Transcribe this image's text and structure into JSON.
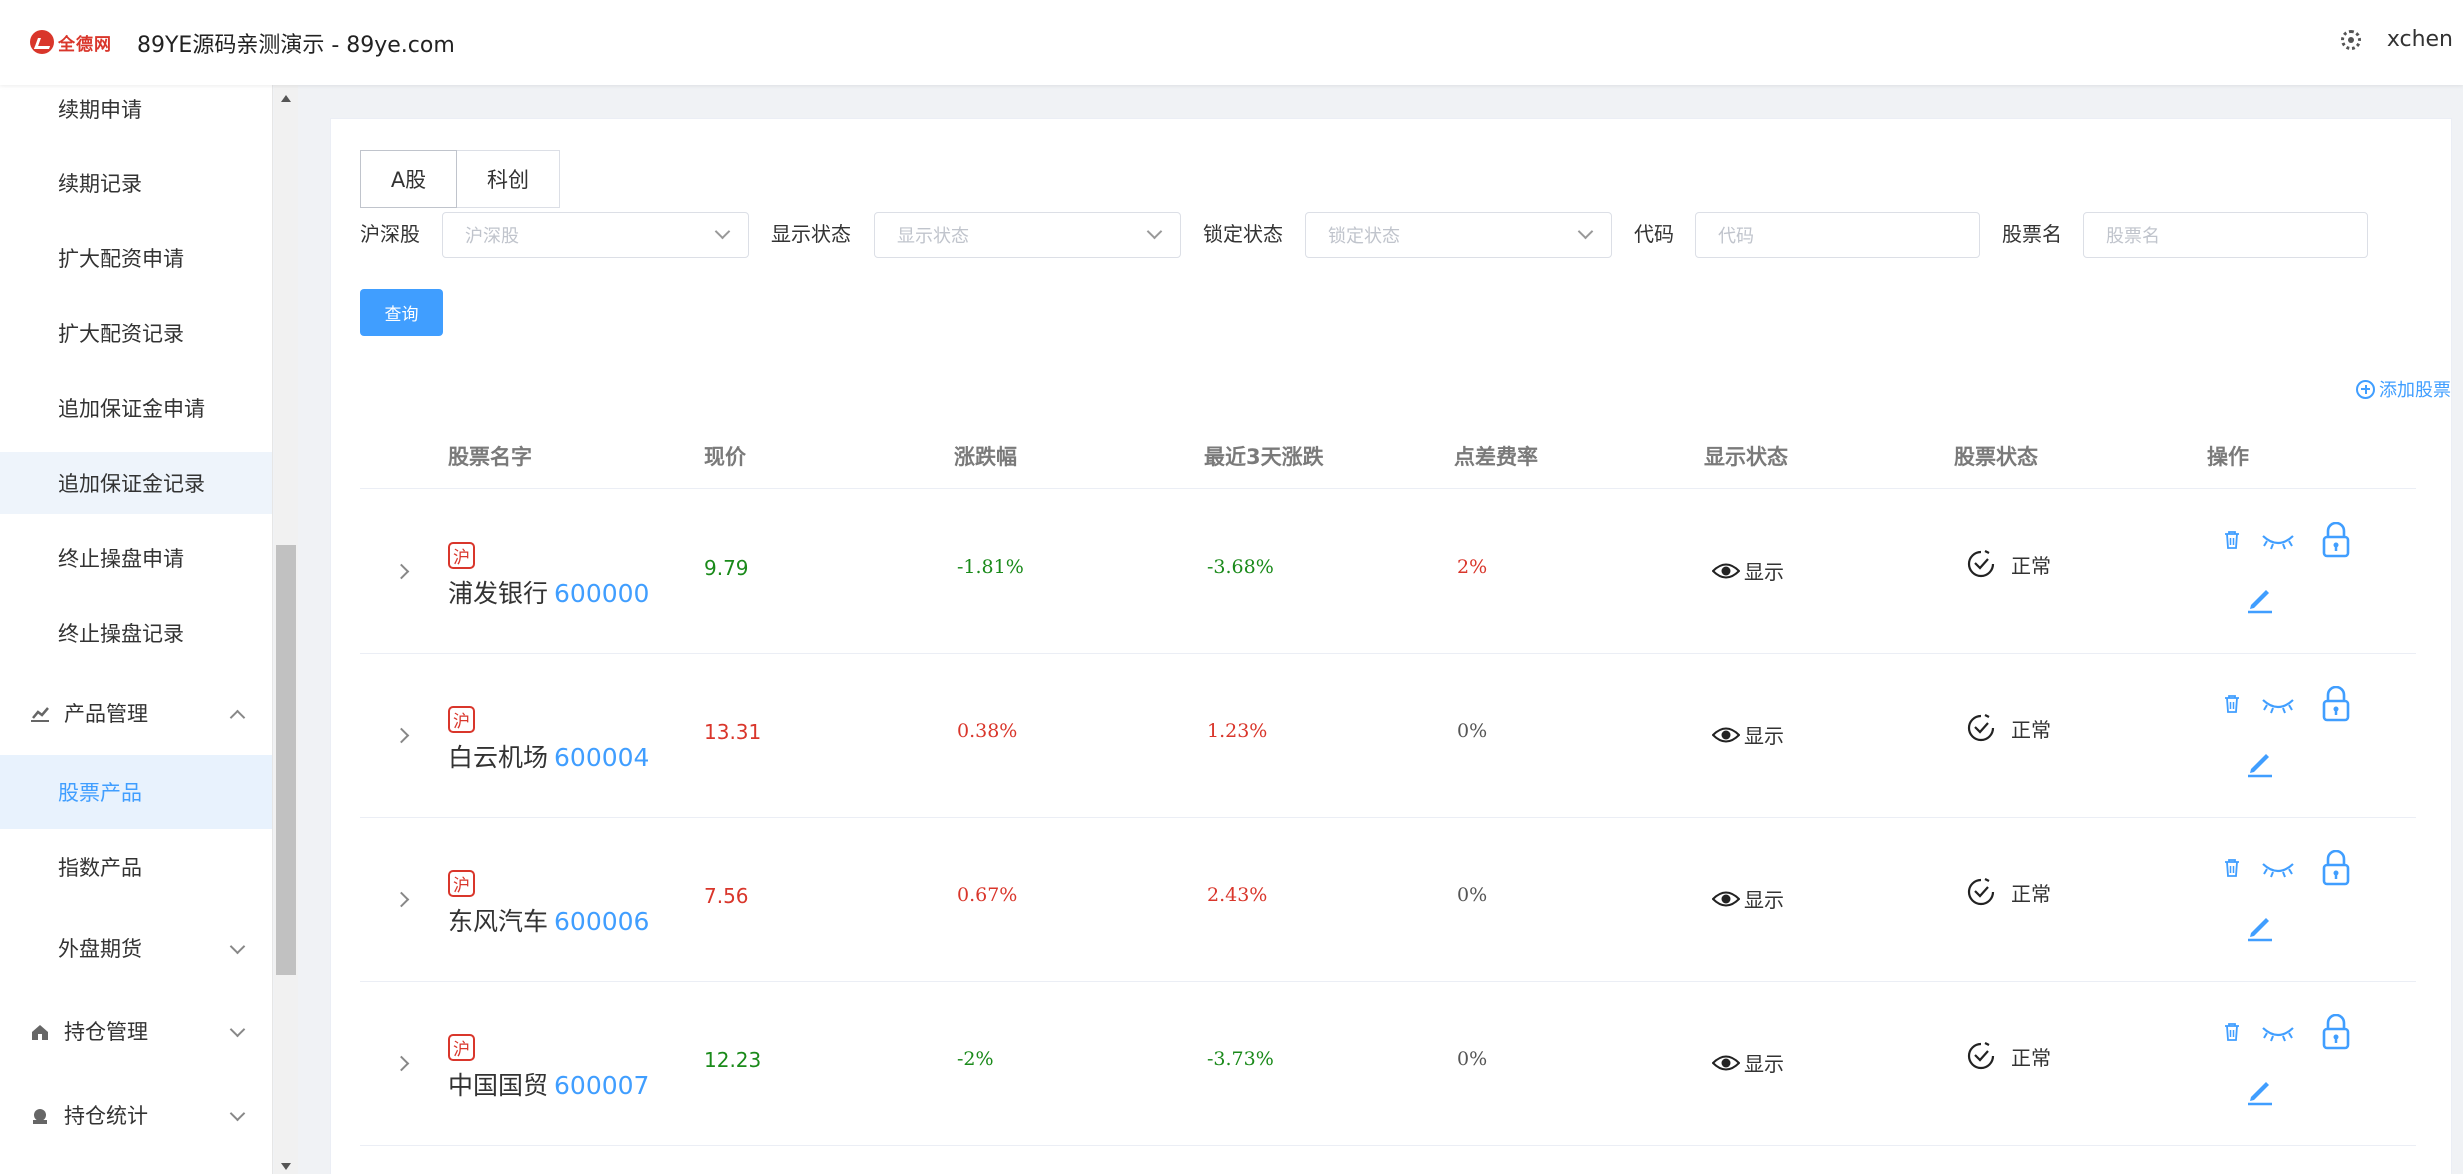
{
  "header": {
    "logo_text": "全德网",
    "title": "89YE源码亲测演示 - 89ye.com",
    "user": "xchen"
  },
  "sidebar": {
    "items": [
      {
        "label": "续期申请"
      },
      {
        "label": "续期记录"
      },
      {
        "label": "扩大配资申请"
      },
      {
        "label": "扩大配资记录"
      },
      {
        "label": "追加保证金申请"
      },
      {
        "label": "追加保证金记录"
      },
      {
        "label": "终止操盘申请"
      },
      {
        "label": "终止操盘记录"
      },
      {
        "label": "产品管理",
        "icon": "chart-icon"
      },
      {
        "label": "股票产品"
      },
      {
        "label": "指数产品"
      },
      {
        "label": "外盘期货"
      },
      {
        "label": "持仓管理",
        "icon": "home-icon"
      },
      {
        "label": "持仓统计",
        "icon": "stats-icon"
      }
    ]
  },
  "tabs": [
    {
      "label": "A股"
    },
    {
      "label": "科创"
    }
  ],
  "filters": {
    "market_label": "沪深股",
    "market_placeholder": "沪深股",
    "display_label": "显示状态",
    "display_placeholder": "显示状态",
    "lock_label": "锁定状态",
    "lock_placeholder": "锁定状态",
    "code_label": "代码",
    "code_placeholder": "代码",
    "name_label": "股票名",
    "name_placeholder": "股票名"
  },
  "query_button": "查询",
  "add_stock": "添加股票",
  "table": {
    "headers": [
      "股票名字",
      "现价",
      "涨跌幅",
      "最近3天涨跌",
      "点差费率",
      "显示状态",
      "股票状态",
      "操作"
    ],
    "rows": [
      {
        "market": "沪",
        "name": "浦发银行",
        "code": "600000",
        "price": "9.79",
        "change": "-1.81%",
        "change3d": "-3.68%",
        "spread": "2%",
        "display": "显示",
        "status": "正常"
      },
      {
        "market": "沪",
        "name": "白云机场",
        "code": "600004",
        "price": "13.31",
        "change": "0.38%",
        "change3d": "1.23%",
        "spread": "0%",
        "display": "显示",
        "status": "正常"
      },
      {
        "market": "沪",
        "name": "东风汽车",
        "code": "600006",
        "price": "7.56",
        "change": "0.67%",
        "change3d": "2.43%",
        "spread": "0%",
        "display": "显示",
        "status": "正常"
      },
      {
        "market": "沪",
        "name": "中国国贸",
        "code": "600007",
        "price": "12.23",
        "change": "-2%",
        "change3d": "-3.73%",
        "spread": "0%",
        "display": "显示",
        "status": "正常"
      }
    ]
  },
  "colors": {
    "accent": "#409eff",
    "up": "#d9362b",
    "down": "#1a8a1a"
  }
}
